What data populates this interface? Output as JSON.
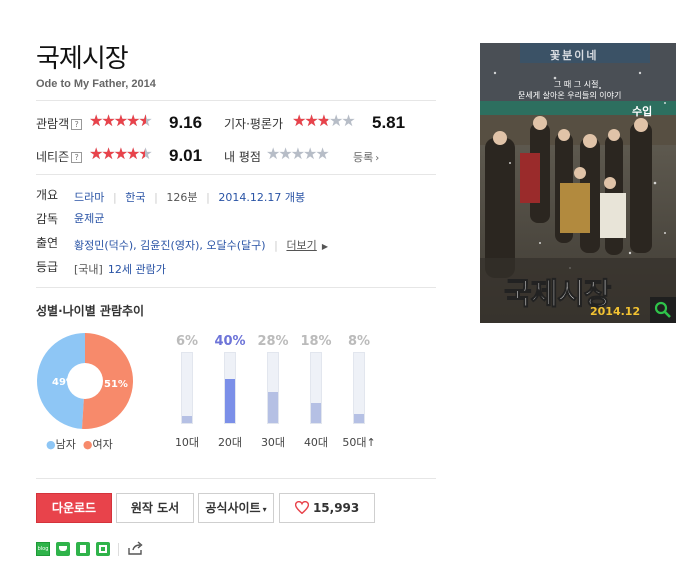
{
  "movie": {
    "title": "국제시장",
    "subtitle": "Ode to My Father, 2014"
  },
  "ratings": {
    "audience": {
      "label": "관람객",
      "help": "?",
      "score": "9.16",
      "stars_fraction": 0.916
    },
    "critic": {
      "label": "기자·평론가",
      "score": "5.81",
      "stars_fraction": 0.581
    },
    "netizen": {
      "label": "네티즌",
      "help": "?",
      "score": "9.01",
      "stars_fraction": 0.901
    },
    "mine": {
      "label": "내 평점",
      "action": "등록",
      "action_icon": "chevron-right-icon"
    }
  },
  "info": {
    "overview": {
      "label": "개요",
      "genre": "드라마",
      "country": "한국",
      "runtime": "126분",
      "release": "2014.12.17 개봉"
    },
    "director": {
      "label": "감독",
      "value": "윤제균"
    },
    "cast": {
      "label": "출연",
      "value": "황정민(덕수), 김윤진(영자), 오달수(달구)",
      "more": "더보기"
    },
    "grade": {
      "label": "등급",
      "prefix": "[국내]",
      "value": "12세 관람가"
    }
  },
  "stats": {
    "title": "성별·나이별 관람추이",
    "gender": {
      "male_pct": 49,
      "female_pct": 51,
      "male_label": "49%",
      "female_label": "51%",
      "legend_male": "남자",
      "legend_female": "여자",
      "male_color": "#8ec6f5",
      "female_color": "#f78a6b"
    },
    "ages": [
      {
        "label": "10대",
        "pct": "6%",
        "value": 6
      },
      {
        "label": "20대",
        "pct": "40%",
        "value": 40,
        "highlight": true
      },
      {
        "label": "30대",
        "pct": "28%",
        "value": 28
      },
      {
        "label": "40대",
        "pct": "18%",
        "value": 18
      },
      {
        "label": "50대↑",
        "pct": "8%",
        "value": 8
      }
    ]
  },
  "buttons": {
    "download": "다운로드",
    "book": "원작 도서",
    "site": "공식사이트",
    "likes": "15,993"
  },
  "poster": {
    "title_text": "국제시장",
    "date": "2014.12",
    "tagline1": "그 때 그 시절",
    "tagline2": "굳세게 살아온 우리들의 이야기",
    "badge": "수입",
    "sign": "꽃분이네"
  },
  "colors": {
    "accent_red": "#e8434b",
    "star_red": "#e8434b",
    "star_gray": "#b7bdc7",
    "link_blue": "#2953a5",
    "highlight_bar": "#7b8fe8",
    "highlight_pct": "#6d74d8"
  }
}
